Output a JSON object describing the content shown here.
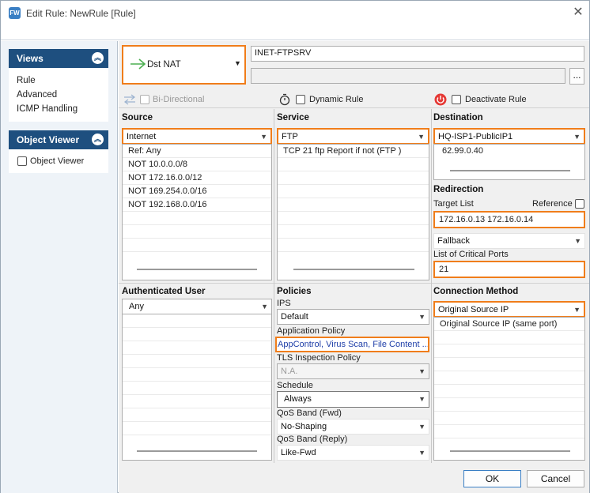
{
  "window": {
    "title": "Edit Rule: NewRule [Rule]",
    "app_icon": "firewall-app-icon",
    "close_icon": "close-icon"
  },
  "left": {
    "views": {
      "header": "Views",
      "items": [
        "Rule",
        "Advanced",
        "ICMP Handling"
      ]
    },
    "object_viewer": {
      "header": "Object Viewer",
      "checkbox_label": "Object Viewer"
    }
  },
  "top": {
    "action": "Dst NAT",
    "action_icon": "arrow-right-icon",
    "rule_name": "INET-FTPSRV",
    "description": "",
    "more_button": "...",
    "bidirectional_label": "Bi-Directional",
    "dynamic_label": "Dynamic Rule",
    "deactivate_label": "Deactivate Rule"
  },
  "source": {
    "title": "Source",
    "selected": "Internet",
    "items": [
      "Ref: Any",
      "NOT 10.0.0.0/8",
      "NOT 172.16.0.0/12",
      "NOT 169.254.0.0/16",
      "NOT 192.168.0.0/16"
    ]
  },
  "service": {
    "title": "Service",
    "selected": "FTP",
    "items": [
      "TCP  21 ftp  Report if not (FTP )"
    ]
  },
  "destination": {
    "title": "Destination",
    "selected": "HQ-ISP1-PublicIP1",
    "items": [
      "62.99.0.40"
    ]
  },
  "redirection": {
    "title": "Redirection",
    "target_list_label": "Target List",
    "reference_label": "Reference",
    "target_list": "172.16.0.13 172.16.0.14",
    "fallback": "Fallback",
    "critical_ports_label": "List of Critical Ports",
    "critical_ports": "21"
  },
  "auth_user": {
    "title": "Authenticated User",
    "selected": "Any"
  },
  "policies": {
    "title": "Policies",
    "ips_label": "IPS",
    "ips": "Default",
    "app_policy_label": "Application Policy",
    "app_policy": "AppControl, Virus Scan, File Content ...",
    "tls_label": "TLS Inspection Policy",
    "tls": "N.A.",
    "schedule_label": "Schedule",
    "schedule": "Always",
    "qos_fwd_label": "QoS Band (Fwd)",
    "qos_fwd": "No-Shaping",
    "qos_reply_label": "QoS Band (Reply)",
    "qos_reply": "Like-Fwd"
  },
  "connection": {
    "title": "Connection Method",
    "selected": "Original Source IP",
    "items": [
      "Original Source IP (same port)"
    ]
  },
  "buttons": {
    "ok": "OK",
    "cancel": "Cancel"
  },
  "colors": {
    "highlight": "#f07d1a",
    "nav_header": "#1e4f7f",
    "link": "#1f3fa8",
    "nat_arrow": "#4caf50",
    "deactivate": "#e53935"
  }
}
